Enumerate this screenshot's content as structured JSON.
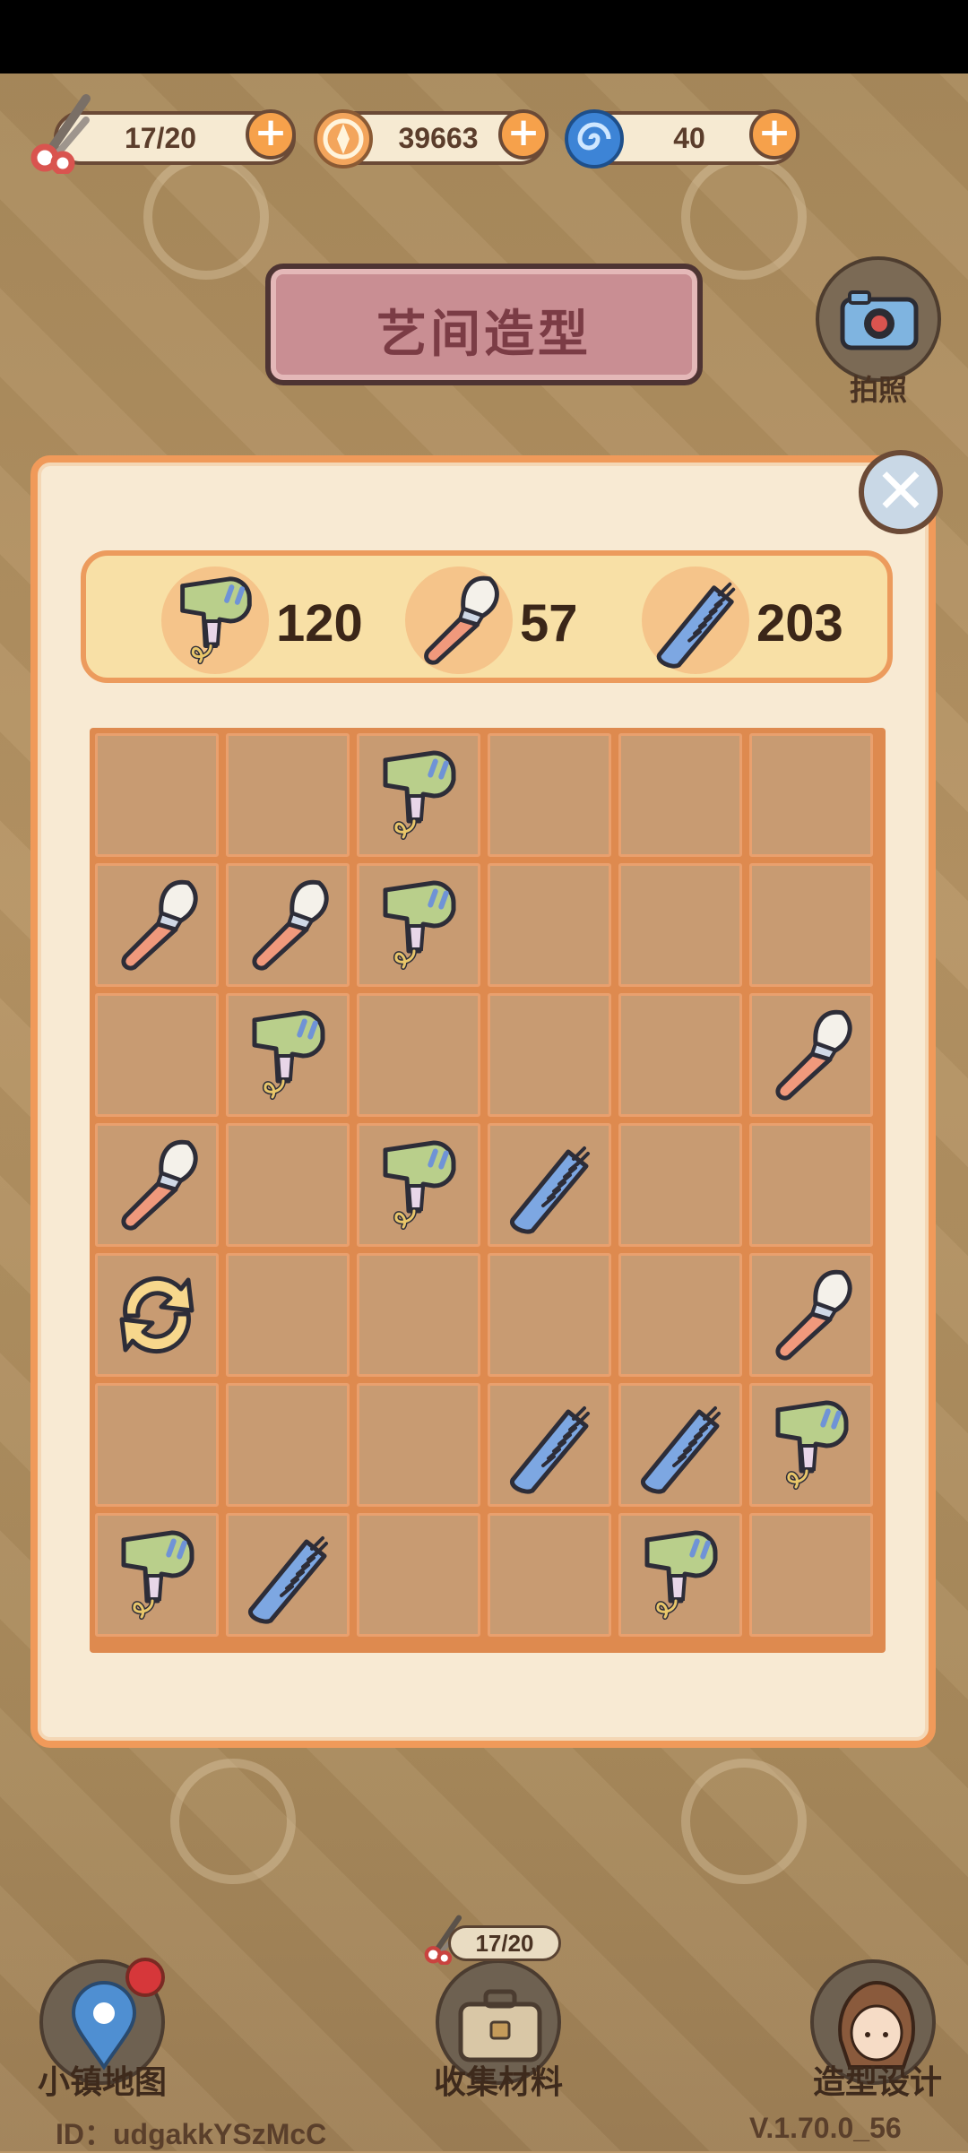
{
  "resources": {
    "scissors": {
      "value": "17/20",
      "icon": "scissors-icon"
    },
    "coins": {
      "value": "39663",
      "icon": "coin-icon"
    },
    "swirl": {
      "value": "40",
      "icon": "blue-swirl-icon"
    },
    "plus_label": "+"
  },
  "title": "艺间造型",
  "camera_label": "拍照",
  "close_label": "✕",
  "counters": [
    {
      "icon": "hair-dryer-icon",
      "value": "120"
    },
    {
      "icon": "makeup-brush-icon",
      "value": "57"
    },
    {
      "icon": "comb-icon",
      "value": "203"
    }
  ],
  "grid": {
    "rows": 7,
    "cols": 6,
    "cells": [
      [
        "",
        "",
        "dryer",
        "",
        "",
        ""
      ],
      [
        "brush",
        "brush",
        "dryer",
        "",
        "",
        ""
      ],
      [
        "",
        "dryer",
        "",
        "",
        "",
        "brush"
      ],
      [
        "brush",
        "",
        "dryer",
        "comb",
        "",
        ""
      ],
      [
        "refresh",
        "",
        "",
        "",
        "",
        "brush"
      ],
      [
        "",
        "",
        "",
        "comb",
        "comb",
        "dryer"
      ],
      [
        "dryer",
        "comb",
        "",
        "",
        "dryer",
        ""
      ]
    ]
  },
  "bottom_nav": [
    {
      "label": "小镇地图",
      "icon": "map-pin-icon"
    },
    {
      "label": "收集材料",
      "icon": "suitcase-icon",
      "count": "17/20"
    },
    {
      "label": "造型设计",
      "icon": "character-avatar-icon"
    }
  ],
  "footer": {
    "id_text": "ID：udgakkYSzMcC",
    "version": "V.1.70.0_56"
  },
  "colors": {
    "panel_border": "#f09a5a",
    "grid_bg": "#de8a4f",
    "cell_bg": "#c89b72",
    "plus_button": "#f6a14b"
  }
}
